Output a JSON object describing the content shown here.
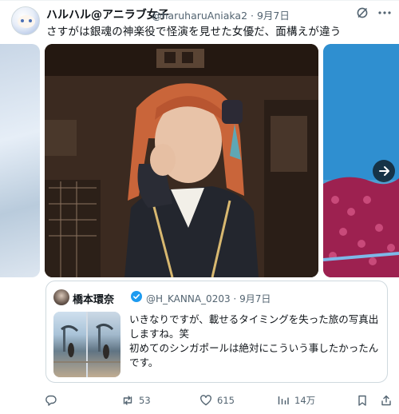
{
  "author": {
    "name": "ハルハル@アニラブ女子",
    "handle": "@haruharuAniaka2",
    "date": "9月7日"
  },
  "tweet": {
    "text": "さすがは銀魂の神楽役で怪演を見せた女優だ、面構えが違う"
  },
  "quoted": {
    "name": "橋本環奈",
    "handle": "@H_KANNA_0203",
    "date": "9月7日",
    "lines": [
      "いきなりですが、載せるタイミングを失った旅の写真出",
      "しますね。笑",
      "初めてのシンガポールは絶対にこういう事したかったん",
      "です。"
    ]
  },
  "actions": {
    "retweets": "53",
    "likes": "615",
    "views": "14万"
  },
  "icons": [
    "more-icon",
    "grok-icon",
    "reply-icon",
    "retweet-icon",
    "like-icon",
    "views-icon",
    "bookmark-icon",
    "share-icon",
    "verified-icon",
    "next-arrow-icon"
  ],
  "colors": {
    "text": "#0f1419",
    "secondary": "#536471",
    "verified": "#1d9bf0",
    "border": "#cfd9de"
  }
}
